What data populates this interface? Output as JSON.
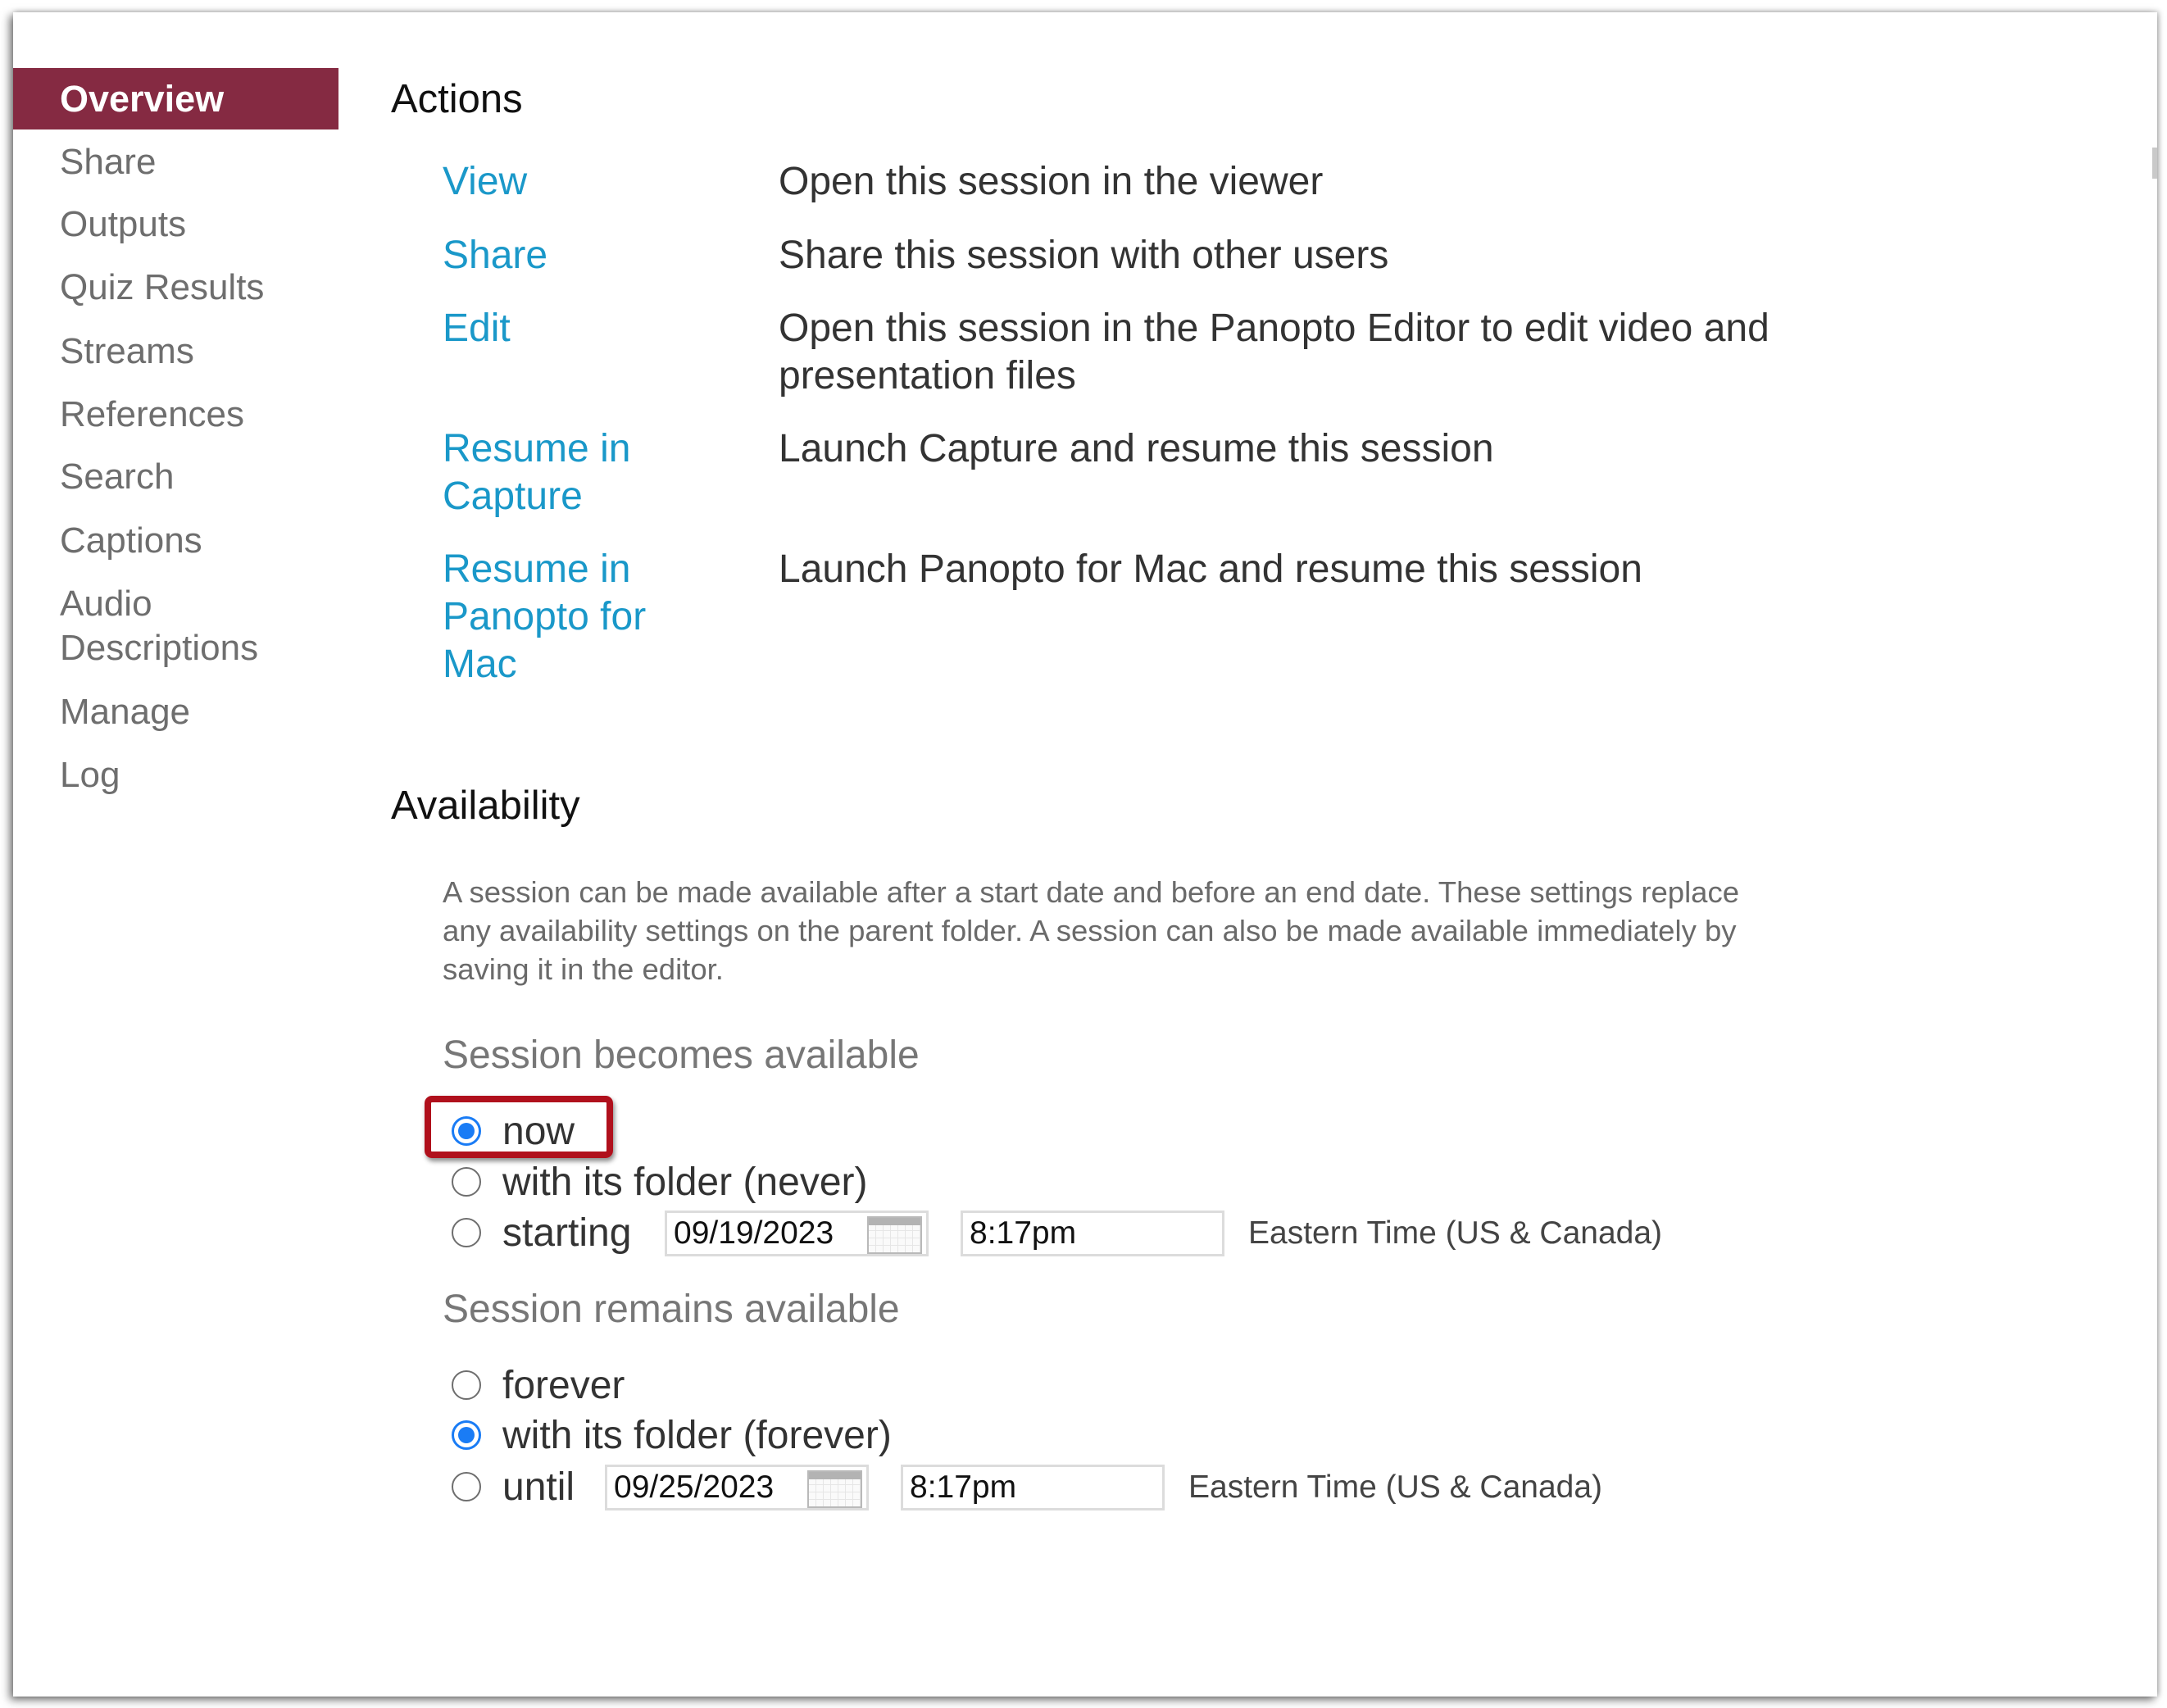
{
  "sidebar": {
    "items": [
      {
        "label": "Overview",
        "active": true
      },
      {
        "label": "Share"
      },
      {
        "label": "Outputs"
      },
      {
        "label": "Quiz Results"
      },
      {
        "label": "Streams"
      },
      {
        "label": "References"
      },
      {
        "label": "Search"
      },
      {
        "label": "Captions"
      },
      {
        "label": "Audio Descriptions"
      },
      {
        "label": "Manage"
      },
      {
        "label": "Log"
      }
    ],
    "audio_line1": "Audio",
    "audio_line2": "Descriptions"
  },
  "actions": {
    "title": "Actions",
    "rows": [
      {
        "link": "View",
        "description": "Open this session in the viewer"
      },
      {
        "link": "Share",
        "description": "Share this session with other users"
      },
      {
        "link": "Edit",
        "description_line1": "Open this session in the Panopto Editor to edit video and",
        "description_line2": "presentation files"
      },
      {
        "link_line1": "Resume in",
        "link_line2": "Capture",
        "description": "Launch Capture and resume this session"
      },
      {
        "link_line1": "Resume in",
        "link_line2": "Panopto for",
        "link_line3": "Mac",
        "description": "Launch Panopto for Mac and resume this session"
      }
    ]
  },
  "availability": {
    "title": "Availability",
    "description": "A session can be made available after a start date and before an end date. These settings replace any availability settings on the parent folder. A session can also be made available immediately by saving it in the editor.",
    "becomes": {
      "heading": "Session becomes available",
      "options": [
        {
          "label": "now",
          "checked": true,
          "highlighted": true
        },
        {
          "label": "with its folder (never)",
          "checked": false
        },
        {
          "label": "starting",
          "checked": false,
          "date": "09/19/2023",
          "time": "8:17pm",
          "timezone": "Eastern Time (US & Canada)"
        }
      ]
    },
    "remains": {
      "heading": "Session remains available",
      "options": [
        {
          "label": "forever",
          "checked": false
        },
        {
          "label": "with its folder (forever)",
          "checked": true
        },
        {
          "label": "until",
          "checked": false,
          "date": "09/25/2023",
          "time": "8:17pm",
          "timezone": "Eastern Time (US & Canada)"
        }
      ]
    }
  },
  "colors": {
    "active_nav": "#852a42",
    "link": "#1a98c9",
    "radio_checked": "#1a7cf5",
    "highlight_box": "#b0101c"
  }
}
